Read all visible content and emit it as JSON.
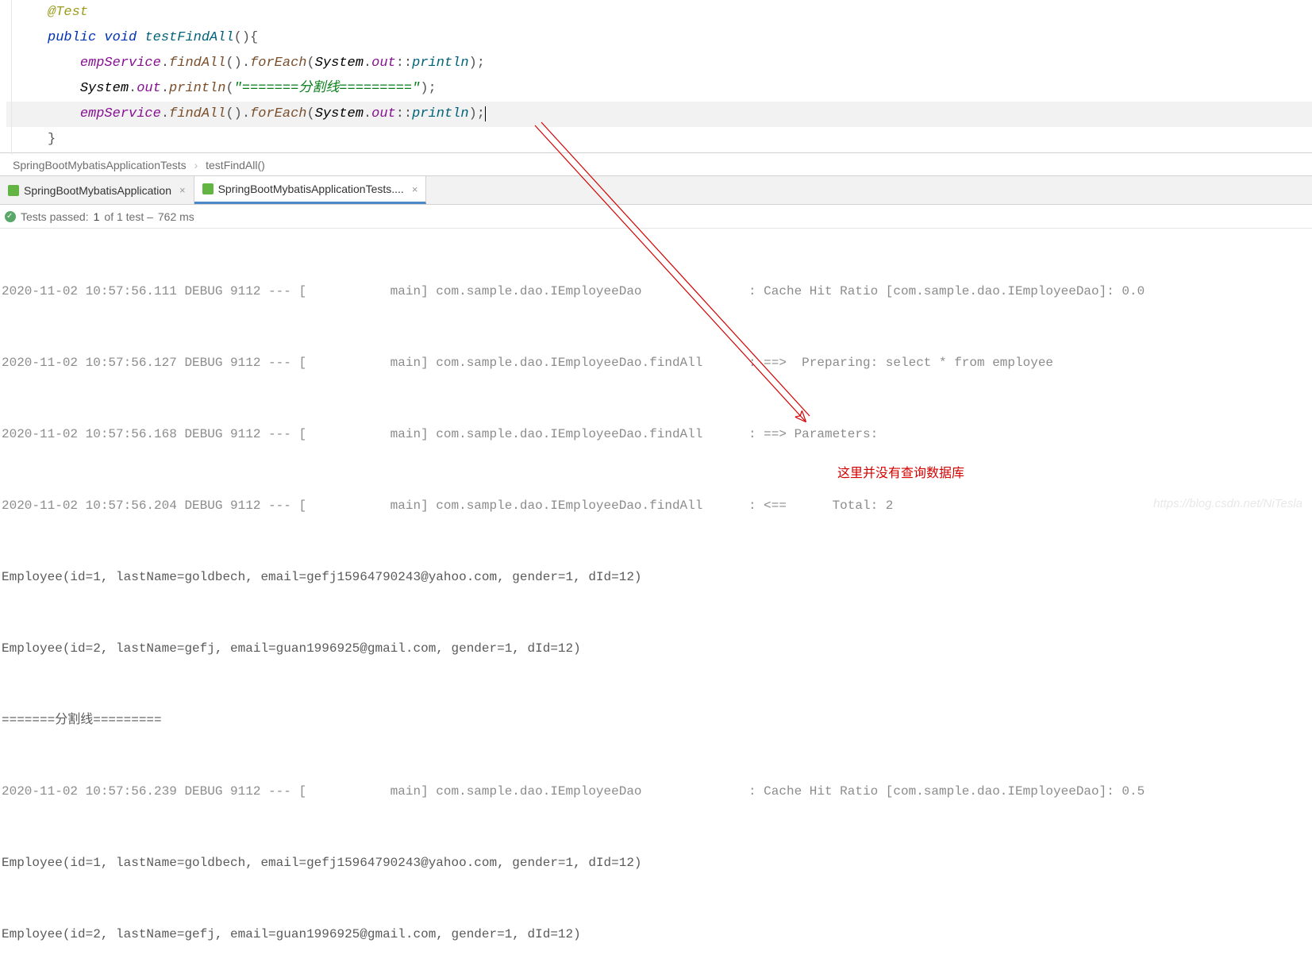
{
  "code": {
    "annotation": "@Test",
    "keyword_public": "public",
    "keyword_void": "void",
    "method_name": "testFindAll",
    "line2_suffix": "(){",
    "field_empService": "empService",
    "method_findAll": "findAll",
    "method_forEach": "forEach",
    "class_system": "System",
    "field_out": "out",
    "ref_println": "println",
    "method_println": "println",
    "string_divider": "\"=======分割线=========\"",
    "close_brace": "}"
  },
  "breadcrumb": {
    "item1": "SpringBootMybatisApplicationTests",
    "item2": "testFindAll()"
  },
  "tabs": {
    "tab1_label": "SpringBootMybatisApplication",
    "tab2_label": "SpringBootMybatisApplicationTests...."
  },
  "status": {
    "prefix": "Tests passed:",
    "count": "1",
    "mid": "of 1 test –",
    "time": "762 ms"
  },
  "console": {
    "lines": [
      "2020-11-02 10:57:56.111 DEBUG 9112 --- [           main] com.sample.dao.IEmployeeDao              : Cache Hit Ratio [com.sample.dao.IEmployeeDao]: 0.0",
      "2020-11-02 10:57:56.127 DEBUG 9112 --- [           main] com.sample.dao.IEmployeeDao.findAll      : ==>  Preparing: select * from employee",
      "2020-11-02 10:57:56.168 DEBUG 9112 --- [           main] com.sample.dao.IEmployeeDao.findAll      : ==> Parameters: ",
      "2020-11-02 10:57:56.204 DEBUG 9112 --- [           main] com.sample.dao.IEmployeeDao.findAll      : <==      Total: 2",
      "Employee(id=1, lastName=goldbech, email=gefj15964790243@yahoo.com, gender=1, dId=12)",
      "Employee(id=2, lastName=gefj, email=guan1996925@gmail.com, gender=1, dId=12)",
      "=======分割线=========",
      "2020-11-02 10:57:56.239 DEBUG 9112 --- [           main] com.sample.dao.IEmployeeDao              : Cache Hit Ratio [com.sample.dao.IEmployeeDao]: 0.5",
      "Employee(id=1, lastName=goldbech, email=gefj15964790243@yahoo.com, gender=1, dId=12)",
      "Employee(id=2, lastName=gefj, email=guan1996925@gmail.com, gender=1, dId=12)"
    ]
  },
  "annotation": {
    "red_note": "这里并没有查询数据库"
  },
  "watermark": "https://blog.csdn.net/NiTesla"
}
